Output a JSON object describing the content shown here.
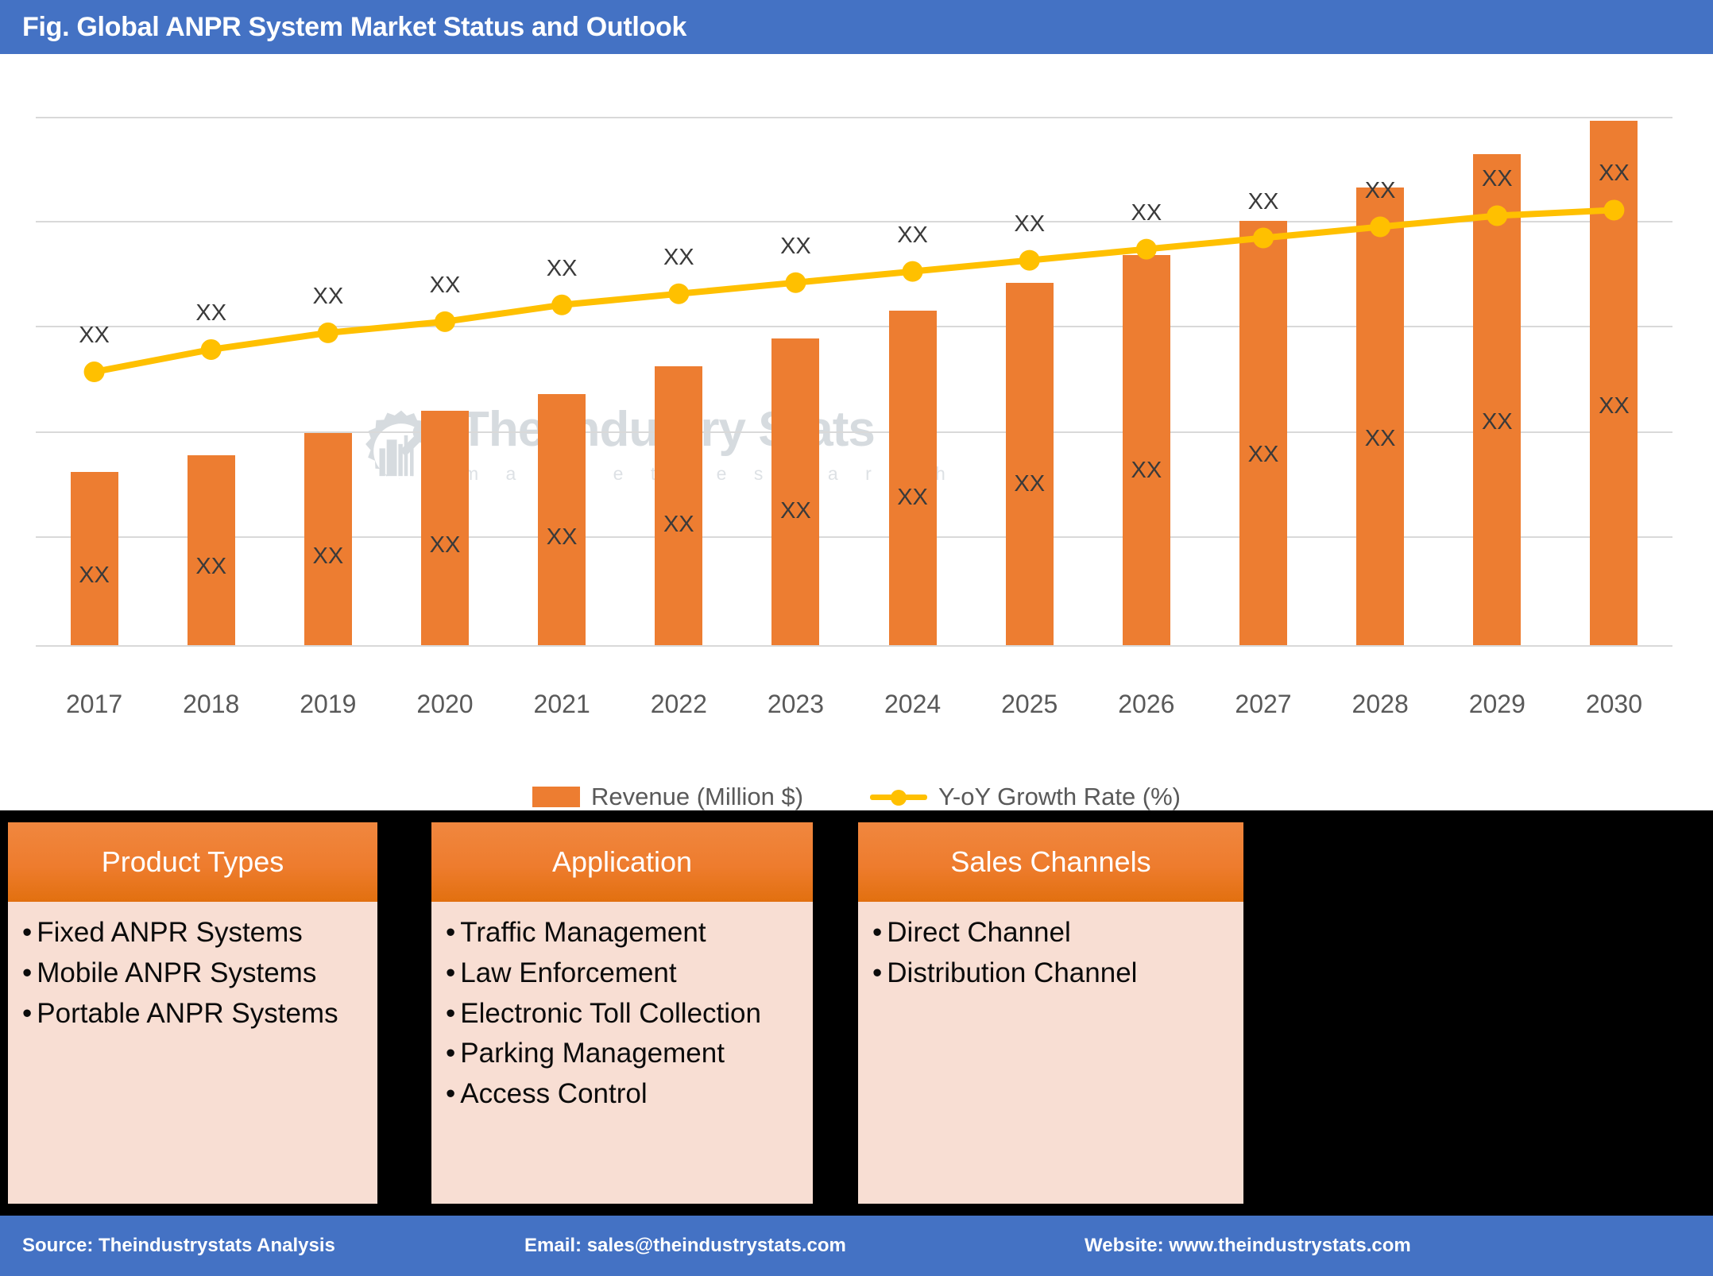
{
  "header": {
    "title": "Fig. Global ANPR System Market Status and Outlook",
    "bg_color": "#4472C4"
  },
  "watermark": {
    "brand": "The Industry Stats",
    "tagline": "m a r k e t   r e s e a r c h",
    "logo_icon": "gear-factory-wrench-icon"
  },
  "chart_data": {
    "type": "bar",
    "title": "Fig. Global ANPR System Market Status and Outlook",
    "xlabel": "",
    "ylabel": "",
    "grid": true,
    "legend_position": "bottom",
    "categories": [
      "2017",
      "2018",
      "2019",
      "2020",
      "2021",
      "2022",
      "2023",
      "2024",
      "2025",
      "2026",
      "2027",
      "2028",
      "2029",
      "2030"
    ],
    "series": [
      {
        "name": "Revenue (Million $)",
        "type": "bar",
        "color": "#ED7D31",
        "axis": "left",
        "values": [
          31,
          34,
          38,
          42,
          45,
          50,
          55,
          60,
          65,
          70,
          76,
          82,
          88,
          94
        ],
        "data_labels": [
          "XX",
          "XX",
          "XX",
          "XX",
          "XX",
          "XX",
          "XX",
          "XX",
          "XX",
          "XX",
          "XX",
          "XX",
          "XX",
          "XX"
        ]
      },
      {
        "name": "Y-oY Growth Rate (%)",
        "type": "line",
        "color": "#FFC000",
        "axis": "right",
        "values": [
          49,
          53,
          56,
          58,
          61,
          63,
          65,
          67,
          69,
          71,
          73,
          75,
          77,
          78
        ],
        "data_labels": [
          "XX",
          "XX",
          "XX",
          "XX",
          "XX",
          "XX",
          "XX",
          "XX",
          "XX",
          "XX",
          "XX",
          "XX",
          "XX",
          "XX"
        ]
      }
    ],
    "ylim": [
      0,
      100
    ],
    "gridline_count": 6
  },
  "legend": {
    "items": [
      {
        "label": "Revenue (Million $)",
        "marker": "bar-swatch",
        "color": "#ED7D31"
      },
      {
        "label": "Y-oY Growth Rate (%)",
        "marker": "line-marker",
        "color": "#FFC000"
      }
    ]
  },
  "panels": [
    {
      "title": "Product Types",
      "items": [
        "Fixed ANPR Systems",
        "Mobile ANPR Systems",
        "Portable ANPR Systems"
      ]
    },
    {
      "title": "Application",
      "items": [
        "Traffic Management",
        "Law Enforcement",
        "Electronic Toll Collection",
        "Parking Management",
        "Access Control"
      ]
    },
    {
      "title": "Sales Channels",
      "items": [
        "Direct Channel",
        "Distribution Channel"
      ]
    }
  ],
  "footer": {
    "source": "Source: Theindustrystats Analysis",
    "email": "Email: sales@theindustrystats.com",
    "website": "Website: www.theindustrystats.com",
    "bg_color": "#4472C4"
  }
}
